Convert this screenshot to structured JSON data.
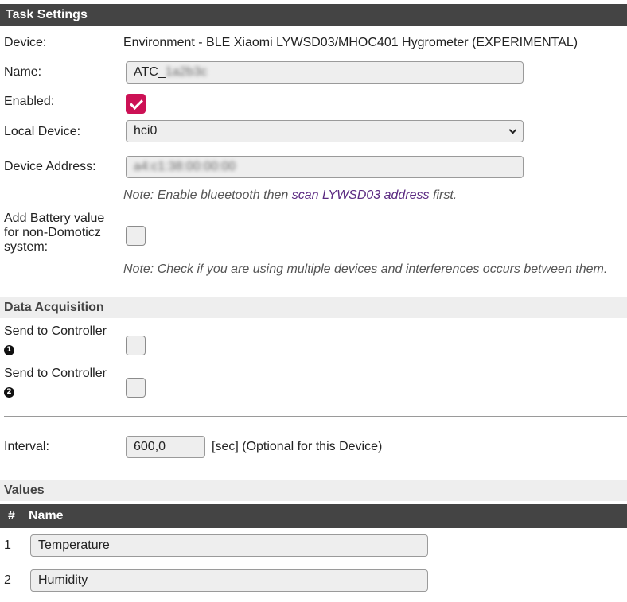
{
  "task_settings": {
    "header": "Task Settings",
    "device_label": "Device:",
    "device_value": "Environment - BLE Xiaomi LYWSD03/MHOC401 Hygrometer (EXPERIMENTAL)",
    "name_label": "Name:",
    "name_value_visible": "ATC_",
    "name_value_blurred": "1a2b3c",
    "enabled_label": "Enabled:",
    "enabled_checked": true,
    "local_device_label": "Local Device:",
    "local_device_value": "hci0",
    "device_address_label": "Device Address:",
    "device_address_blurred": "a4:c1:38:00:00:00",
    "note1_prefix": "Note: Enable blueetooth then ",
    "note1_link": "scan LYWSD03 address",
    "note1_suffix": " first.",
    "battery_label_l1": "Add Battery value",
    "battery_label_l2": "for non-Domoticz",
    "battery_label_l3": "system:",
    "battery_checked": false,
    "note2": "Note: Check if you are using multiple devices and interferences occurs between them."
  },
  "data_acquisition": {
    "header": "Data Acquisition",
    "controllers": [
      {
        "label": "Send to Controller",
        "badge": "1",
        "checked": false
      },
      {
        "label": "Send to Controller",
        "badge": "2",
        "checked": false
      }
    ],
    "interval_label": "Interval:",
    "interval_value": "600,0",
    "interval_unit": "[sec] (Optional for this Device)"
  },
  "values": {
    "header": "Values",
    "col_num": "#",
    "col_name": "Name",
    "rows": [
      {
        "num": "1",
        "name": "Temperature"
      },
      {
        "num": "2",
        "name": "Humidity"
      }
    ]
  },
  "colors": {
    "header_dark": "#444444",
    "header_light": "#eeeeee",
    "accent": "#cc1155",
    "link": "#5b2a82"
  }
}
